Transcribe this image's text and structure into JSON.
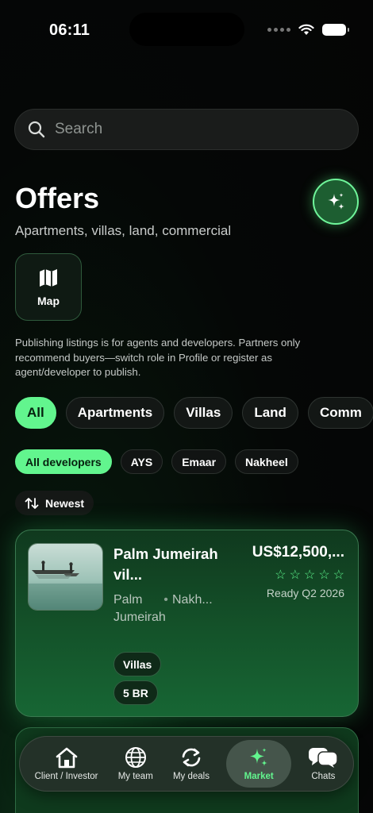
{
  "status_bar": {
    "time": "06:11"
  },
  "search": {
    "placeholder": "Search"
  },
  "header": {
    "title": "Offers",
    "subtitle": "Apartments, villas, land, commercial"
  },
  "map_button": {
    "label": "Map"
  },
  "notice": "Publishing listings is for agents and developers. Partners only recommend buyers—switch role in Profile or register as agent/developer to publish.",
  "categories": [
    {
      "label": "All",
      "active": true
    },
    {
      "label": "Apartments",
      "active": false
    },
    {
      "label": "Villas",
      "active": false
    },
    {
      "label": "Land",
      "active": false
    },
    {
      "label": "Comm",
      "active": false
    }
  ],
  "developers": [
    {
      "label": "All developers",
      "active": true
    },
    {
      "label": "AYS",
      "active": false
    },
    {
      "label": "Emaar",
      "active": false
    },
    {
      "label": "Nakheel",
      "active": false
    }
  ],
  "sort": {
    "label": "Newest"
  },
  "listing": {
    "title": "Palm Jumeirah vil...",
    "price": "US$12,500,...",
    "rating_stars": 5,
    "ready": "Ready Q2 2026",
    "area": "Palm Jumeirah",
    "developer": "Nakh...",
    "tags": [
      "Villas",
      "5 BR"
    ]
  },
  "tabbar": [
    {
      "label": "Client / Investor",
      "icon": "home-icon",
      "active": false
    },
    {
      "label": "My team",
      "icon": "globe-icon",
      "active": false
    },
    {
      "label": "My deals",
      "icon": "sync-icon",
      "active": false
    },
    {
      "label": "Market",
      "icon": "sparkle-icon",
      "active": true
    },
    {
      "label": "Chats",
      "icon": "chat-bubbles-icon",
      "active": false
    }
  ],
  "colors": {
    "accent": "#62f58e",
    "card_bg": "#14532a",
    "background": "#050505"
  }
}
